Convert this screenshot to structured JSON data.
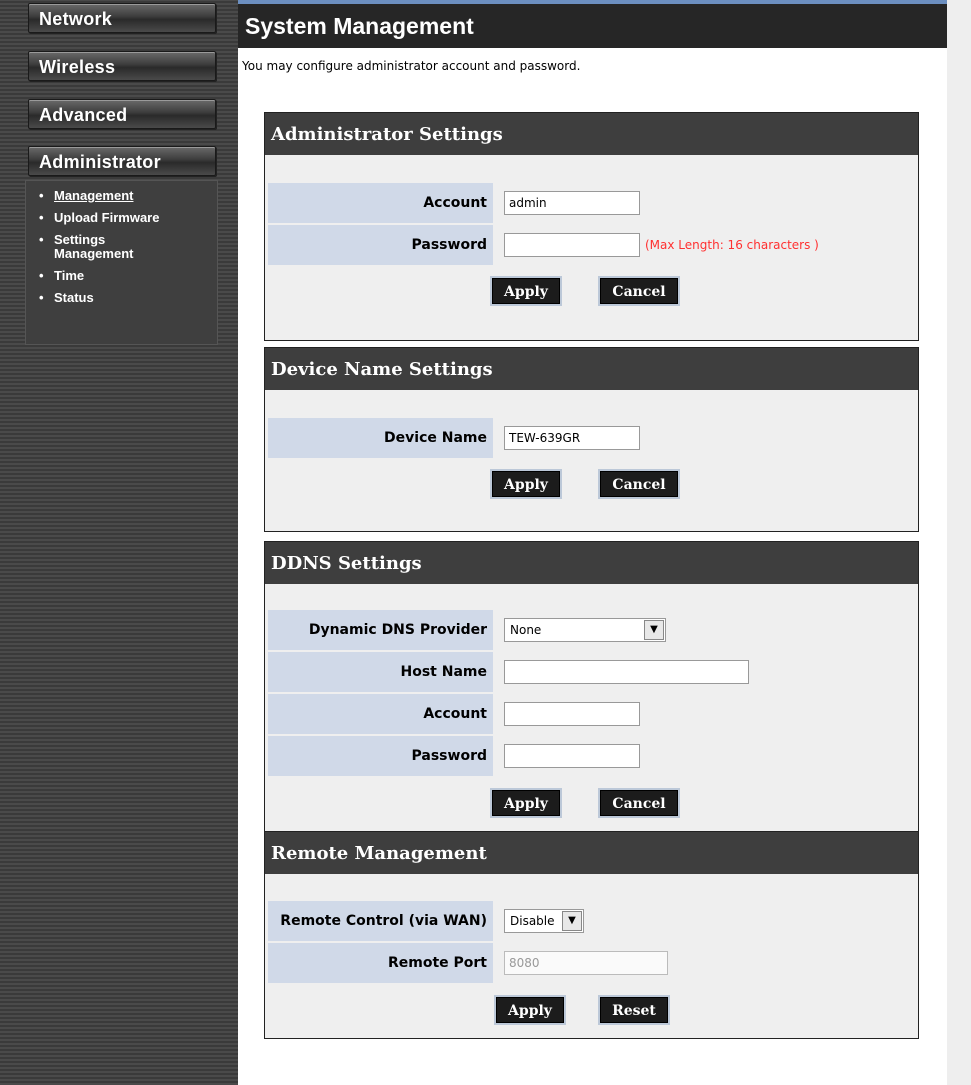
{
  "nav": {
    "network": "Network",
    "wireless": "Wireless",
    "advanced": "Advanced",
    "administrator": "Administrator",
    "submenu": [
      "Management",
      "Upload Firmware",
      "Settings\nManagement",
      "Time",
      "Status"
    ]
  },
  "page": {
    "title": "System Management",
    "description": "You may configure administrator account and password."
  },
  "admin": {
    "heading": "Administrator Settings",
    "account_label": "Account",
    "account_value": "admin",
    "password_label": "Password",
    "password_value": "",
    "password_hint": "(Max Length: 16 characters )",
    "apply": "Apply",
    "cancel": "Cancel"
  },
  "device": {
    "heading": "Device Name Settings",
    "name_label": "Device Name",
    "name_value": "TEW-639GR",
    "apply": "Apply",
    "cancel": "Cancel"
  },
  "ddns": {
    "heading": "DDNS Settings",
    "provider_label": "Dynamic DNS Provider",
    "provider_value": "None",
    "host_label": "Host Name",
    "host_value": "",
    "account_label": "Account",
    "account_value": "",
    "password_label": "Password",
    "password_value": "",
    "apply": "Apply",
    "cancel": "Cancel"
  },
  "remote": {
    "heading": "Remote Management",
    "control_label": "Remote Control (via WAN)",
    "control_value": "Disable",
    "port_label": "Remote Port",
    "port_value": "8080",
    "apply": "Apply",
    "reset": "Reset"
  },
  "colors": {
    "header_bar": "#262626",
    "section_header": "#3e3e3e",
    "label_bg": "#d0d9e8",
    "hint_red": "#ff3030",
    "top_line_blue": "#6c8fc0"
  }
}
